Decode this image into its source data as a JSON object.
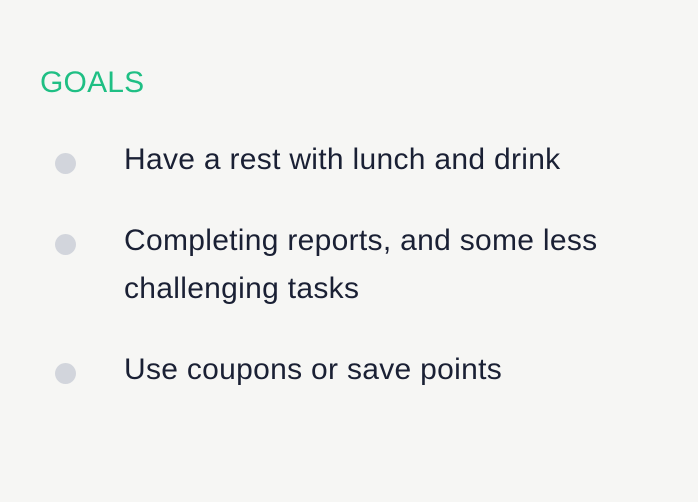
{
  "goals": {
    "title": "GOALS",
    "title_color": "#1fbf84",
    "bullet_color": "#d2d5dc",
    "text_color": "#1a2034",
    "items": [
      {
        "text": "Have a rest with lunch and drink"
      },
      {
        "text": "Completing reports, and some less challenging tasks"
      },
      {
        "text": "Use coupons or save points"
      }
    ]
  }
}
